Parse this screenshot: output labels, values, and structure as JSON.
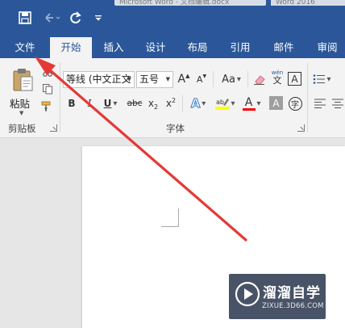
{
  "titlebar": {
    "bg_color": "#2b579a",
    "quick_access": [
      {
        "name": "save-icon"
      },
      {
        "name": "undo-icon"
      },
      {
        "name": "redo-icon"
      },
      {
        "name": "customize-qat-icon"
      }
    ],
    "doc_tab_1": "Microsoft Word - 文档编辑.docx",
    "doc_tab_2": "Word 2016"
  },
  "tabs": {
    "file": "文件",
    "home": "开始",
    "insert": "插入",
    "design": "设计",
    "layout": "布局",
    "references": "引用",
    "mailings": "邮件",
    "review": "审阅"
  },
  "clipboard": {
    "paste_label": "粘贴",
    "group_label": "剪贴板"
  },
  "font": {
    "font_name": "等线 (中文正文",
    "font_size": "五号",
    "grow_label": "A",
    "shrink_label": "A",
    "case_label": "Aa",
    "pinyin_label": "wén",
    "pinyin_char": "文",
    "border_char": "A",
    "bold": "B",
    "italic": "I",
    "underline": "U",
    "strike": "abc",
    "subscript": "x",
    "sub_mark": "2",
    "superscript": "x",
    "sup_mark": "2",
    "effects": "A",
    "font_color": "A",
    "shade_char": "A",
    "enclose_char": "字",
    "group_label": "字体"
  },
  "colors": {
    "accent": "#2b579a",
    "annotation_arrow": "#e53935",
    "highlight_yellow": "#ffff00",
    "font_color_red": "#ff0000",
    "watermark_bg": "#14223c"
  },
  "watermark": {
    "title": "溜溜自学",
    "subtitle": "ZIXUE.3D66.COM"
  }
}
